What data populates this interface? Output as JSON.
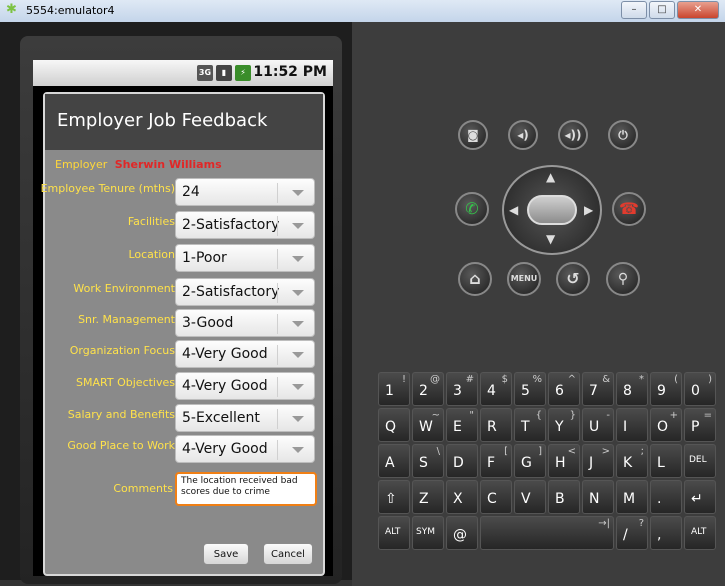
{
  "window": {
    "title": "5554:emulator4",
    "minimize": "–",
    "maximize": "□",
    "close": "✕"
  },
  "status": {
    "three_g": "3G",
    "clock": "11:52 PM"
  },
  "dialog": {
    "title": "Employer Job Feedback",
    "employer_label": "Employer",
    "employer_name": "Sherwin Williams",
    "fields": [
      {
        "label": "Employee Tenure (mths)",
        "value": "24"
      },
      {
        "label": "Facilities",
        "value": "2-Satisfactory"
      },
      {
        "label": "Location",
        "value": "1-Poor"
      },
      {
        "label": "Work Environment",
        "value": "2-Satisfactory"
      },
      {
        "label": "Snr. Management",
        "value": "3-Good"
      },
      {
        "label": "Organization Focus",
        "value": "4-Very Good"
      },
      {
        "label": "SMART Objectives",
        "value": "4-Very Good"
      },
      {
        "label": "Salary and Benefits",
        "value": "5-Excellent"
      },
      {
        "label": "Good Place to Work",
        "value": "4-Very Good"
      }
    ],
    "comments_label": "Comments",
    "comments_value": "The location received bad scores due to crime",
    "save": "Save",
    "cancel": "Cancel"
  },
  "controls": {
    "menu": "MENU"
  },
  "keyboard": {
    "row1": [
      {
        "k": "1",
        "a": "!"
      },
      {
        "k": "2",
        "a": "@"
      },
      {
        "k": "3",
        "a": "#"
      },
      {
        "k": "4",
        "a": "$"
      },
      {
        "k": "5",
        "a": "%"
      },
      {
        "k": "6",
        "a": "^"
      },
      {
        "k": "7",
        "a": "&"
      },
      {
        "k": "8",
        "a": "*"
      },
      {
        "k": "9",
        "a": "("
      },
      {
        "k": "0",
        "a": ")"
      }
    ],
    "row2": [
      {
        "k": "Q",
        "a": ""
      },
      {
        "k": "W",
        "a": "~"
      },
      {
        "k": "E",
        "a": "\""
      },
      {
        "k": "R",
        "a": ""
      },
      {
        "k": "T",
        "a": "{"
      },
      {
        "k": "Y",
        "a": "}"
      },
      {
        "k": "U",
        "a": "-"
      },
      {
        "k": "I",
        "a": ""
      },
      {
        "k": "O",
        "a": "+"
      },
      {
        "k": "P",
        "a": "="
      }
    ],
    "row3": [
      {
        "k": "A",
        "a": ""
      },
      {
        "k": "S",
        "a": "\\"
      },
      {
        "k": "D",
        "a": ""
      },
      {
        "k": "F",
        "a": "["
      },
      {
        "k": "G",
        "a": "]"
      },
      {
        "k": "H",
        "a": "<"
      },
      {
        "k": "J",
        "a": ">"
      },
      {
        "k": "K",
        "a": ";"
      },
      {
        "k": "L",
        "a": ""
      },
      {
        "k": "DEL",
        "a": ""
      }
    ],
    "row4": [
      {
        "k": "⇧",
        "a": ""
      },
      {
        "k": "Z",
        "a": ""
      },
      {
        "k": "X",
        "a": ""
      },
      {
        "k": "C",
        "a": ""
      },
      {
        "k": "V",
        "a": ""
      },
      {
        "k": "B",
        "a": ""
      },
      {
        "k": "N",
        "a": ""
      },
      {
        "k": "M",
        "a": ""
      },
      {
        "k": ".",
        "a": ""
      },
      {
        "k": "↵",
        "a": ""
      }
    ],
    "row5": [
      {
        "k": "ALT",
        "a": ""
      },
      {
        "k": "SYM",
        "a": ""
      },
      {
        "k": "@",
        "a": ""
      },
      {
        "k": "",
        "a": ""
      },
      {
        "k": "/",
        "a": "?"
      },
      {
        "k": ",",
        "a": ""
      },
      {
        "k": "ALT",
        "a": ""
      }
    ]
  }
}
